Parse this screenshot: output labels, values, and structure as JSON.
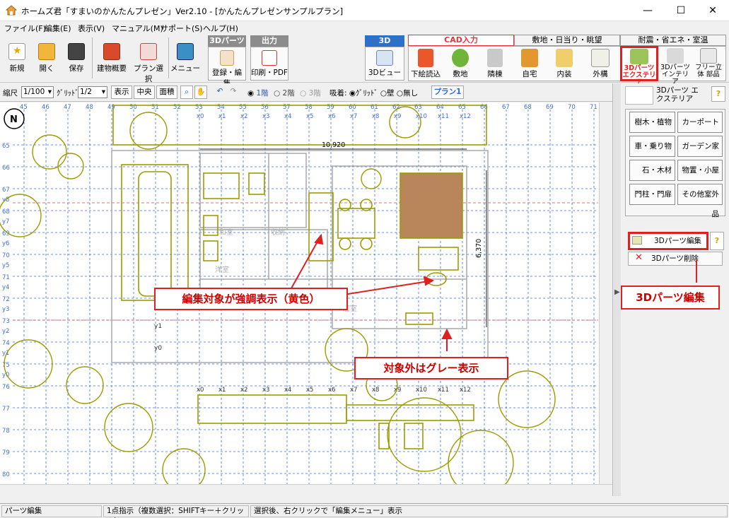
{
  "window": {
    "title": "ホームズ君「すまいのかんたんプレゼン」Ver2.10 - [かんたんプレゼンサンプルプラン]",
    "controls": {
      "minimize": "—",
      "maximize": "☐",
      "close": "✕"
    }
  },
  "menu": [
    "ファイル(F)",
    "編集(E)",
    "表示(V)",
    "マニュアル(M)",
    "サポート(S)",
    "ヘルプ(H)"
  ],
  "toolbar": {
    "buttons": [
      "新規",
      "開く",
      "保存",
      "建物概要",
      "プラン選択",
      "メニュー"
    ],
    "group_3d_parts": {
      "header": "3Dパーツ",
      "button": "登録・編集"
    },
    "group_output": {
      "header": "出力",
      "button": "印刷・PDF"
    },
    "group_3d": {
      "header": "3D",
      "button": "3Dビュー"
    },
    "tabs": [
      "CAD入力",
      "敷地・日当り・眺望",
      "耐震・省エネ・室温"
    ],
    "cad_buttons": [
      "下絵読込",
      "敷地",
      "隣棟",
      "自宅",
      "内装",
      "外構",
      "3Dパーツ エクステリア",
      "3Dパーツ インテリア",
      "フリー立体 部品"
    ]
  },
  "toolbar2": {
    "scale_label": "縮尺",
    "scale_value": "1/100",
    "grid_label": "ｸﾞﾘｯﾄﾞ",
    "grid_value": "1/2",
    "btn_display": "表示",
    "btn_center": "中央",
    "btn_area": "面積",
    "floors": [
      "1階",
      "2階",
      "3階"
    ],
    "selected_floor": "1階",
    "snap_label": "吸着:",
    "snap_options": [
      "ｸﾞﾘｯﾄﾞ",
      "壁",
      "無し"
    ],
    "selected_snap": "ｸﾞﾘｯﾄﾞ",
    "plan": "プラン1"
  },
  "canvas": {
    "dimension_top": "10,920",
    "dimension_right": "6,370",
    "x_ticks": [
      "45",
      "46",
      "47",
      "48",
      "49",
      "50",
      "51",
      "52",
      "53",
      "54",
      "55",
      "56",
      "57",
      "58",
      "59",
      "60",
      "61",
      "62",
      "63",
      "64",
      "65",
      "66",
      "67",
      "68",
      "69",
      "70",
      "71"
    ],
    "x_marks": [
      "x0",
      "x1",
      "x2",
      "x3",
      "x4",
      "x5",
      "x6",
      "x7",
      "x8",
      "x9",
      "x10",
      "x11",
      "x12"
    ],
    "y_ticks": [
      "65",
      "66",
      "67",
      "68",
      "69",
      "70",
      "71",
      "72",
      "73",
      "74",
      "75",
      "76",
      "77",
      "78",
      "79",
      "80"
    ],
    "y_marks": [
      "y8",
      "y7",
      "y6",
      "y5",
      "y4",
      "y3",
      "y2",
      "y1",
      "y0"
    ],
    "inner_y_marks": [
      "y1",
      "y0"
    ],
    "room_labels": [
      "和室",
      "収納",
      "洋室",
      "居室"
    ],
    "north_symbol": "N"
  },
  "panel": {
    "header": "3Dパーツ エクステリア",
    "help": "?",
    "categories": [
      "樹木・植物",
      "カーポート",
      "車・乗り物",
      "ガーデン家具",
      "石・木材",
      "物置・小屋",
      "門柱・門扉",
      "その他室外品"
    ],
    "edit_button": "3Dパーツ編集",
    "delete_button": "3Dパーツ削除"
  },
  "status": [
    "パーツ編集",
    "1点指示（複数選択：SHIFTキー＋クリック）",
    "選択後、右クリックで「編集メニュー」表示"
  ],
  "callouts": {
    "highlight": "編集対象が強調表示（黄色）",
    "gray": "対象外はグレー表示",
    "edit": "3Dパーツ編集"
  },
  "colors": {
    "accent_red": "#e02020",
    "highlight_yellow": "#9c9c00",
    "grid_blue": "#3b6fe0",
    "tab_red": "#e8343e"
  }
}
